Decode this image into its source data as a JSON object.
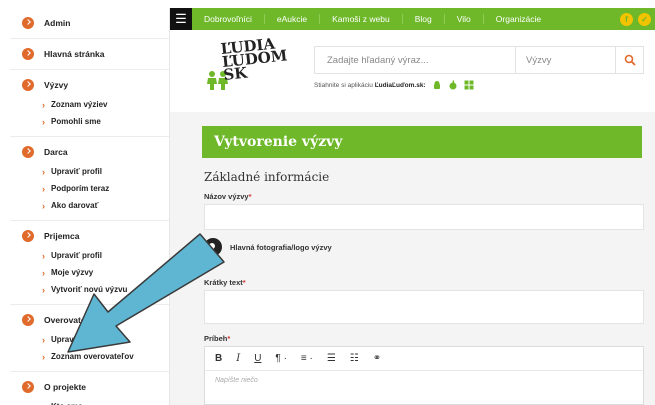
{
  "sidebar": {
    "sections": [
      {
        "label": "Admin",
        "items": []
      },
      {
        "label": "Hlavná stránka",
        "items": []
      },
      {
        "label": "Výzvy",
        "items": [
          "Zoznam výziev",
          "Pomohli sme"
        ]
      },
      {
        "label": "Darca",
        "items": [
          "Upraviť profil",
          "Podporím teraz",
          "Ako darovať"
        ]
      },
      {
        "label": "Prijemca",
        "items": [
          "Upraviť profil",
          "Moje výzvy",
          "Vytvoriť novú výzvu"
        ]
      },
      {
        "label": "Overovateľ",
        "items": [
          "Upraviť profil",
          "Zoznam overovateľov"
        ]
      },
      {
        "label": "O projekte",
        "items": [
          "Kto sme"
        ]
      }
    ]
  },
  "topnav": {
    "menu_icon": "hamburger-icon",
    "items": [
      "Dobrovoľníci",
      "eAukcie",
      "Kamoši z webu",
      "Blog",
      "Vilo",
      "Organizácie"
    ],
    "social_icons": [
      "facebook-icon",
      "social-icon"
    ]
  },
  "header": {
    "logo_text": "ĽUDIA ĽUDOM SK",
    "search_placeholder": "Zadajte hľadaný výraz...",
    "search_select": "Výzvy",
    "apps_prefix": "Stiahnite si aplikáciu ",
    "apps_brand": "ĽudiaĽuďom.sk:"
  },
  "form": {
    "banner_title": "Vytvorenie výzvy",
    "section_title": "Základné informácie",
    "name_label": "Názov výzvy",
    "photo_label": "Hlavná fotografia/logo výzvy",
    "short_text_label": "Krátky text",
    "story_label": "Príbeh",
    "required_mark": "*",
    "editor_placeholder": "Napíšte niečo",
    "toolbar": [
      "B",
      "I",
      "U",
      "¶ ·",
      "≡ ·",
      "☰",
      "☷",
      "⚭"
    ]
  },
  "colors": {
    "brand_green": "#6eb82a",
    "accent_orange": "#e06a2c",
    "arrow_blue": "#5fb6d3"
  }
}
